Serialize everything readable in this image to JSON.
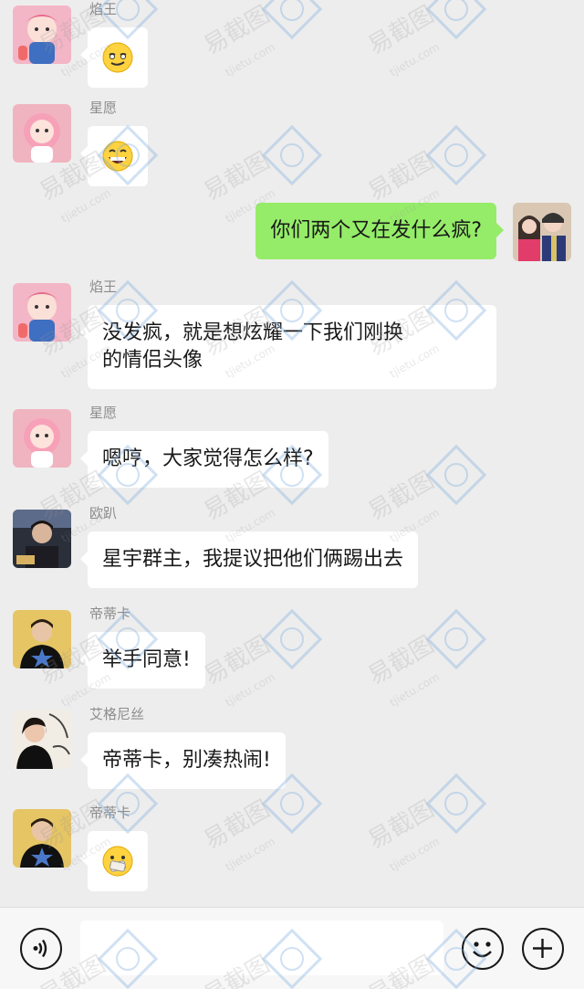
{
  "messages": [
    {
      "side": "left",
      "sender": "焰王",
      "type": "emoji",
      "emoji": "smirk-emoji",
      "avatar": "pink-cartoon-avatar-1"
    },
    {
      "side": "left",
      "sender": "星愿",
      "type": "emoji",
      "emoji": "grin-emoji",
      "avatar": "pink-cartoon-avatar-2"
    },
    {
      "side": "right",
      "sender": "",
      "type": "text",
      "text": "你们两个又在发什么疯?",
      "avatar": "couple-photo-avatar"
    },
    {
      "side": "left",
      "sender": "焰王",
      "type": "text",
      "lines": [
        "没发疯，就是想炫耀一下我们刚换",
        "的情侣头像"
      ],
      "avatar": "pink-cartoon-avatar-1"
    },
    {
      "side": "left",
      "sender": "星愿",
      "type": "text",
      "text": "嗯哼，大家觉得怎么样?",
      "avatar": "pink-cartoon-avatar-2"
    },
    {
      "side": "left",
      "sender": "欧趴",
      "type": "text",
      "text": "星宇群主，我提议把他们俩踢出去",
      "avatar": "dark-photo-avatar"
    },
    {
      "side": "left",
      "sender": "帝蒂卡",
      "type": "text",
      "text": "举手同意!",
      "avatar": "yellow-star-avatar"
    },
    {
      "side": "left",
      "sender": "艾格尼丝",
      "type": "text",
      "text": "帝蒂卡，别凑热闹!",
      "avatar": "girl-photo-avatar"
    },
    {
      "side": "left",
      "sender": "帝蒂卡",
      "type": "emoji",
      "emoji": "zipped-mouth-emoji",
      "avatar": "yellow-star-avatar"
    }
  ],
  "input_bar": {
    "voice_icon": "voice-icon",
    "text_value": "",
    "emoji_icon": "emoji-icon",
    "plus_icon": "plus-icon"
  },
  "watermark": {
    "text": "易截图",
    "url": "tjietu.com"
  },
  "colors": {
    "background": "#ededed",
    "bubble_green": "#95ec69",
    "bubble_white": "#ffffff",
    "sender": "#8c8c8c"
  }
}
